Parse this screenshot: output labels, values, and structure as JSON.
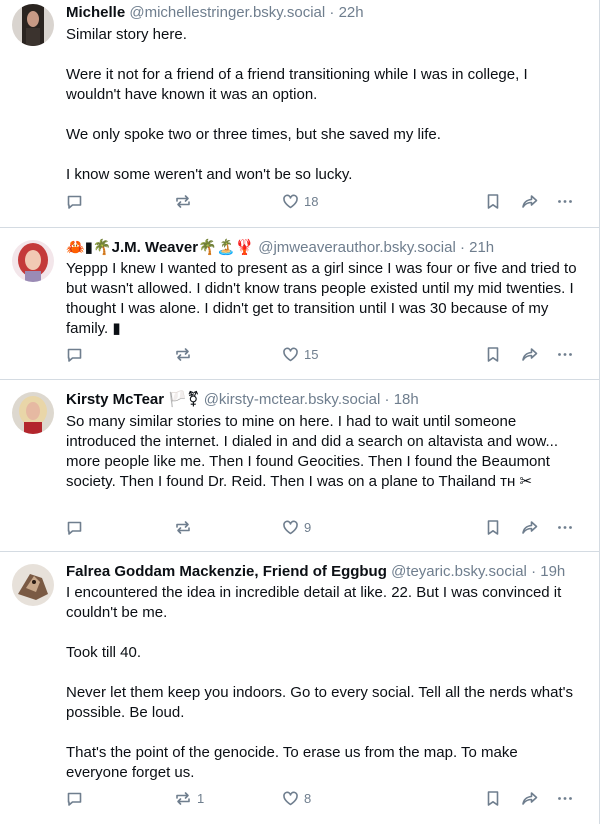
{
  "posts": [
    {
      "name": "Michelle",
      "handle": "@michellestringer.bsky.social",
      "separator": "·",
      "time": "22h",
      "paragraphs": [
        "Similar story here.",
        "",
        "Were it not for a friend of a friend transitioning while I was in college, I wouldn't have known it was an option.",
        "",
        "We only spoke two or three times, but she saved my life.",
        "",
        "I know some weren't and won't be so lucky."
      ],
      "replies": "",
      "reposts": "",
      "likes": "18"
    },
    {
      "name_prefix": "🦀▮🌴",
      "name": "J.M. Weaver",
      "name_suffix": "🌴🏝️🦞",
      "handle": "@jmweaverauthor.bsky.social",
      "separator": "·",
      "time": "21h",
      "paragraphs": [
        "Yeppp I knew I wanted to present as a girl since I was four or five and tried to but wasn't allowed. I didn't know trans people existed until my mid twenties. I thought I was alone. I didn't get to transition until I was 30 because of my family. ▮"
      ],
      "replies": "",
      "reposts": "",
      "likes": "15"
    },
    {
      "name": "Kirsty McTear",
      "name_suffix": "🏳️⚧",
      "handle": "@kirsty-mctear.bsky.social",
      "separator": "·",
      "time": "18h",
      "paragraphs": [
        "So many similar stories to mine on here. I had to wait until someone introduced the internet. I dialed in and did a search on altavista and wow... more people like me. Then I found Geocities. Then I found the Beaumont society. Then I found Dr. Reid. Then I was on a plane to Thailand ᴛʜ ✂"
      ],
      "replies": "",
      "reposts": "",
      "likes": "9"
    },
    {
      "name": "Falrea Goddam Mackenzie, Friend of Eggbug",
      "handle": "@teyaric.bsky.social",
      "separator": "·",
      "time": "19h",
      "paragraphs": [
        "I encountered the idea in incredible detail at like. 22. But I was convinced it couldn't be me.",
        "",
        "Took till 40.",
        "",
        "Never let them keep you indoors. Go to every social. Tell all the nerds what's possible. Be loud.",
        "",
        "That's the point of the genocide. To erase us from the map. To make everyone forget us."
      ],
      "replies": "",
      "reposts": "1",
      "likes": "8"
    }
  ],
  "icons": {
    "reply": "reply-bubble-icon",
    "repost": "repost-arrows-icon",
    "like": "heart-icon",
    "bookmark": "bookmark-icon",
    "share": "share-arrow-icon",
    "more": "more-dots-icon"
  },
  "colors": {
    "text": "#0b0f14",
    "muted": "#6f7e8e",
    "divider": "#d4dbe2"
  }
}
